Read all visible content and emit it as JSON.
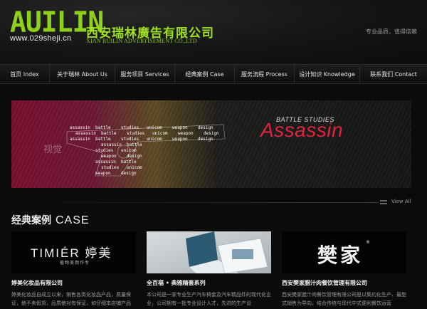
{
  "header": {
    "logo_text": "AUILIN",
    "url": "www.029sheji.cn",
    "company_cn": "西安瑞林廣告有限公司",
    "company_en": "XIAN RUILIN ADVERTISEMENT CO.,LTD",
    "slogan": "专业品质，值得信赖"
  },
  "nav": [
    {
      "label": "首页  Index",
      "width": 70
    },
    {
      "label": "关于瑞林  About Us",
      "width": 92
    },
    {
      "label": "服务项目  Services",
      "width": 84
    },
    {
      "label": "经典案例  Case",
      "width": 84
    },
    {
      "label": "服务流程  Process",
      "width": 84
    },
    {
      "label": "设计知识  Knowledge",
      "width": 92
    },
    {
      "label": "联系我们  Contact",
      "width": 94
    }
  ],
  "banner": {
    "watermark": "视觉",
    "tagline": "BATTLE STUDIES",
    "title": "Assassin",
    "gun_words": [
      "assassin",
      "battle",
      "studies",
      "unicom",
      "weapon",
      "design"
    ],
    "colors": {
      "title": "#e0243f",
      "left": "#7a0f2f"
    }
  },
  "view_all": "View All",
  "section": {
    "title_cn": "经典案例",
    "title_en": "CASE"
  },
  "cases": [
    {
      "thumb_kind": "timier",
      "logo": "TIMIÉR 婷美",
      "logo_sub": "植物美颜作专",
      "title": "婷美化妆品有限公司",
      "desc": "婷美化妆品自成立以来，销售各类化妆品产品，质量保证，绝不卖假货，品质绝对有保证，如仔细本店铺产品"
    },
    {
      "thumb_kind": "photo",
      "title": "全百福 • 典雅精套系列",
      "desc": "本公司是一家专业生产汽车椅套及汽车精品件的现代化企业，公司拥有一批专业设计人才，先进的生产设"
    },
    {
      "thumb_kind": "fanjia",
      "logo": "樊家",
      "logo_mark": "®",
      "title": "西安樊家腊汁肉餐饮管理有限公司",
      "desc": "西安樊家腊汁肉餐饮管理有限公司是以集约化生产、最型式销售为导向，结合传统与现代中式便利餐饮运营"
    }
  ]
}
